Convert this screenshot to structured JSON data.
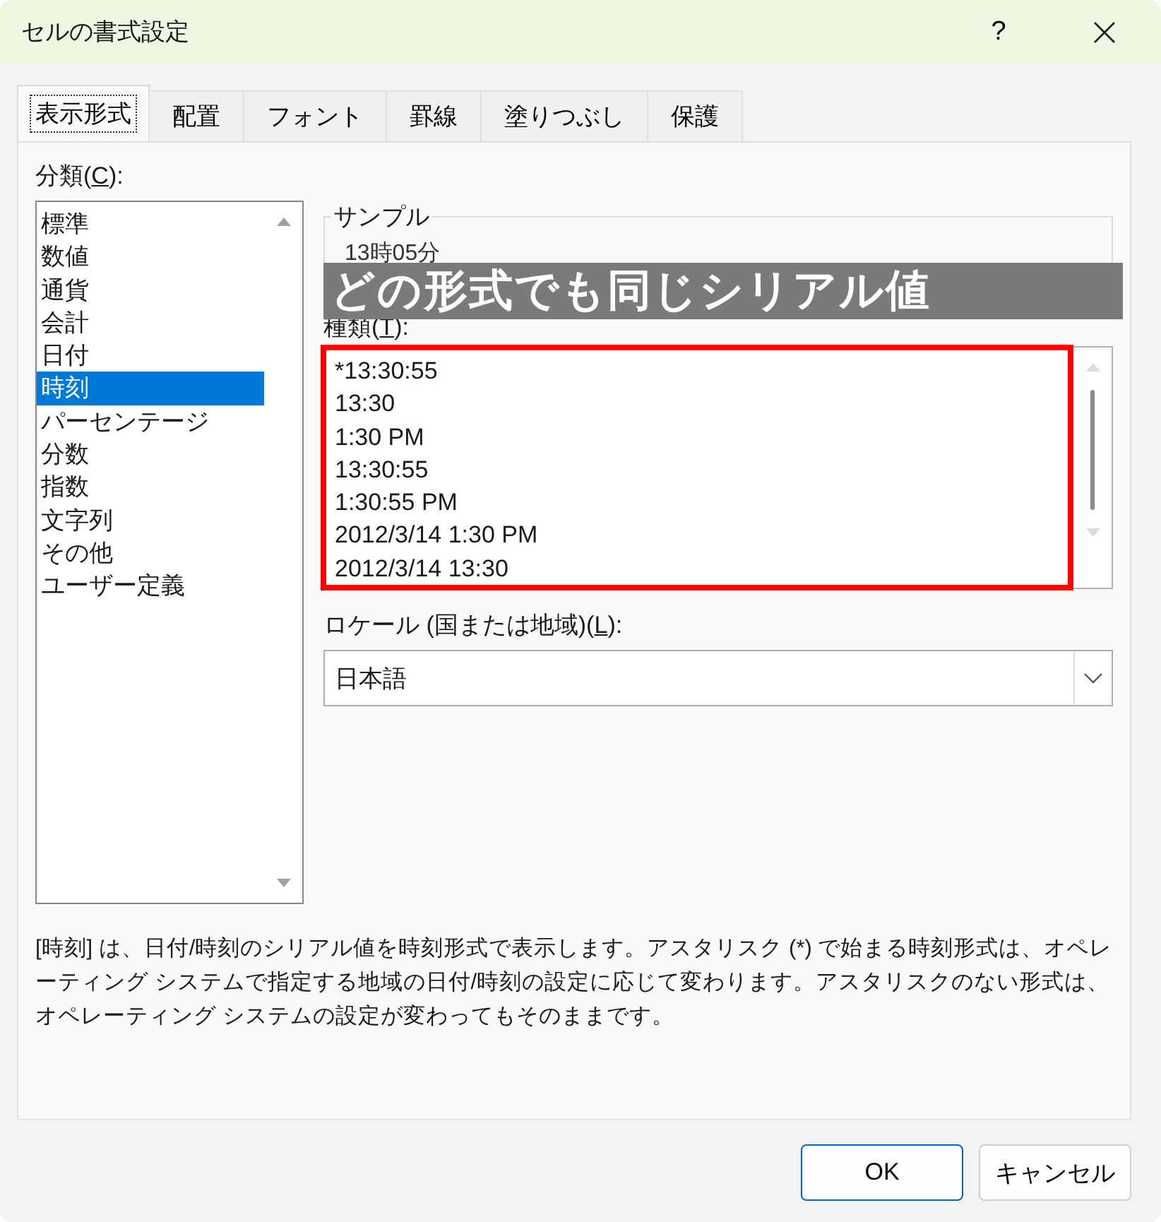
{
  "window": {
    "title": "セルの書式設定",
    "help": "?"
  },
  "tabs": [
    {
      "label": "表示形式",
      "selected": true
    },
    {
      "label": "配置",
      "selected": false
    },
    {
      "label": "フォント",
      "selected": false
    },
    {
      "label": "罫線",
      "selected": false
    },
    {
      "label": "塗りつぶし",
      "selected": false
    },
    {
      "label": "保護",
      "selected": false
    }
  ],
  "category": {
    "label_parts": [
      "分類(",
      "C",
      "):"
    ],
    "items": [
      {
        "label": "標準",
        "selected": false
      },
      {
        "label": "数値",
        "selected": false
      },
      {
        "label": "通貨",
        "selected": false
      },
      {
        "label": "会計",
        "selected": false
      },
      {
        "label": "日付",
        "selected": false
      },
      {
        "label": "時刻",
        "selected": true
      },
      {
        "label": "パーセンテージ",
        "selected": false
      },
      {
        "label": "分数",
        "selected": false
      },
      {
        "label": "指数",
        "selected": false
      },
      {
        "label": "文字列",
        "selected": false
      },
      {
        "label": "その他",
        "selected": false
      },
      {
        "label": "ユーザー定義",
        "selected": false
      }
    ]
  },
  "sample": {
    "label": "サンプル",
    "value": "13時05分"
  },
  "overlay_caption": "どの形式でも同じシリアル値",
  "type": {
    "label_parts": [
      "種類(",
      "T",
      "):"
    ],
    "items": [
      "*13:30:55",
      "13:30",
      "1:30 PM",
      "13:30:55",
      "1:30:55 PM",
      "2012/3/14 1:30 PM",
      "2012/3/14 13:30"
    ]
  },
  "locale": {
    "label_parts": [
      "ロケール (国または地域)(",
      "L",
      "):"
    ],
    "value": "日本語"
  },
  "description": "[時刻] は、日付/時刻のシリアル値を時刻形式で表示します。アスタリスク (*) で始まる時刻形式は、オペレーティング システムで指定する地域の日付/時刻の設定に応じて変わります。アスタリスクのない形式は、オペレーティング システムの設定が変わってもそのままです。",
  "buttons": [
    {
      "label": "OK",
      "kind": "default"
    },
    {
      "label": "キャンセル",
      "kind": "normal"
    }
  ]
}
